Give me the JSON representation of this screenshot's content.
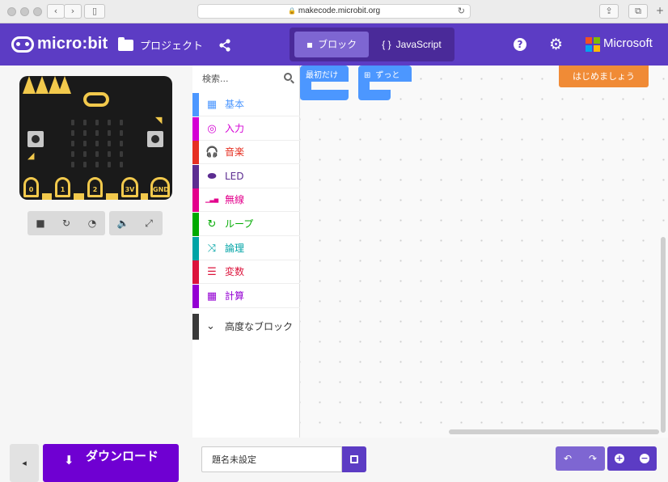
{
  "browser": {
    "url": "makecode.microbit.org"
  },
  "header": {
    "logo_text": "micro:bit",
    "projects_label": "プロジェクト",
    "mode_blocks_label": "ブロック",
    "mode_js_label": "JavaScript",
    "microsoft_label": "Microsoft",
    "active_mode": "blocks",
    "brand_color": "#5c3cc4"
  },
  "simulator": {
    "pins": [
      "0",
      "1",
      "2",
      "3V",
      "GND"
    ],
    "controls": [
      "stop-icon",
      "restart-icon",
      "slow-motion-icon",
      "sound-icon",
      "fullscreen-icon"
    ]
  },
  "toolbox": {
    "search_placeholder": "検索...",
    "categories": [
      {
        "label": "基本",
        "color": "#4c97ff",
        "icon": "grid-icon"
      },
      {
        "label": "入力",
        "color": "#d400d4",
        "icon": "target-icon"
      },
      {
        "label": "音楽",
        "color": "#e63022",
        "icon": "headphones-icon"
      },
      {
        "label": "LED",
        "color": "#5c2d91",
        "icon": "toggle-icon"
      },
      {
        "label": "無線",
        "color": "#e3008c",
        "icon": "signal-icon"
      },
      {
        "label": "ループ",
        "color": "#00aa00",
        "icon": "loop-icon"
      },
      {
        "label": "論理",
        "color": "#00a4a6",
        "icon": "shuffle-icon"
      },
      {
        "label": "変数",
        "color": "#dc143c",
        "icon": "list-icon"
      },
      {
        "label": "計算",
        "color": "#9400d3",
        "icon": "calculator-icon"
      }
    ],
    "advanced_label": "高度なブロック"
  },
  "workspace": {
    "blocks": [
      {
        "label": "最初だけ",
        "icon": "plug-icon"
      },
      {
        "label": "ずっと",
        "icon": "grid-icon"
      }
    ],
    "tutorial_button": "はじめましょう"
  },
  "footer": {
    "download_label": "ダウンロード",
    "project_name": "題名未設定"
  }
}
